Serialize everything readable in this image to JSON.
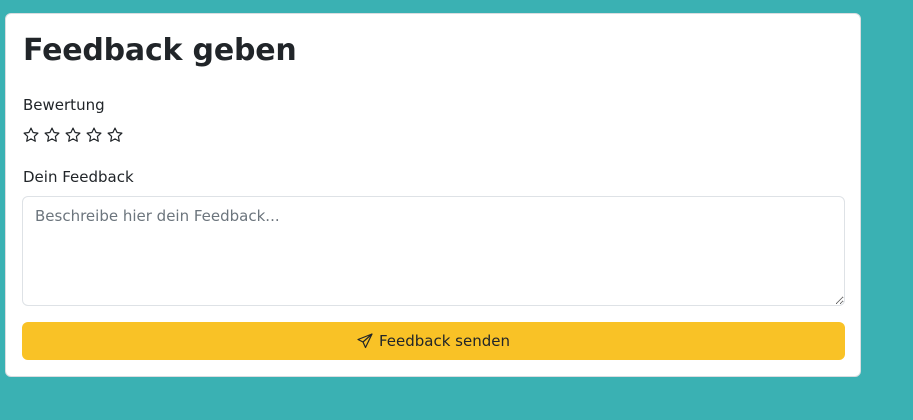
{
  "form": {
    "title": "Feedback geben",
    "rating_label": "Bewertung",
    "rating": {
      "value": 0,
      "max": 5
    },
    "feedback_label": "Dein Feedback",
    "feedback_value": "",
    "feedback_placeholder": "Beschreibe hier dein Feedback...",
    "submit_label": "Feedback senden",
    "submit_icon": "send-icon",
    "star_icon": "star-outline-icon"
  },
  "colors": {
    "background": "#3ab1b3",
    "card": "#ffffff",
    "button": "#f9c226",
    "text": "#212529"
  }
}
